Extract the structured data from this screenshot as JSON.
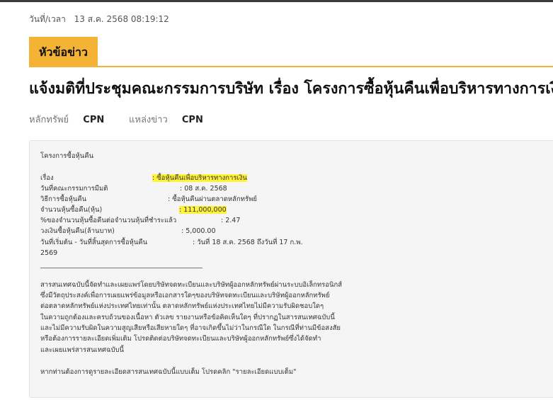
{
  "datetime": {
    "label": "วันที่/เวลา",
    "value": "13 ส.ค. 2568 08:19:12"
  },
  "section_tab": "หัวข้อข่าว",
  "headline": "แจ้งมติที่ประชุมคณะกรรมการบริษัท เรื่อง โครงการซื้อหุ้นคืนเพื่อบริหารทางการเงิน",
  "meta": {
    "security_label": "หลักทรัพย์",
    "security_value": "CPN",
    "source_label": "แหล่งข่าว",
    "source_value": "CPN"
  },
  "news": {
    "heading": "โครงการซื้อหุ้นคืน",
    "fields": [
      {
        "label": "เรื่อง",
        "value": ": ซื้อหุ้นคืนเพื่อบริหารทางการเงิน"
      },
      {
        "label": "วันที่คณะกรรมการมีมติ",
        "value": ": 08 ส.ค. 2568"
      },
      {
        "label": "วิธีการซื้อหุ้นคืน",
        "value": ": ซื้อหุ้นคืนผ่านตลาดหลักทรัพย์"
      },
      {
        "label": "จำนวนหุ้นซื้อคืน(หุ้น)",
        "value": ": 111,000,000"
      },
      {
        "label": "%ของจำนวนหุ้นซื้อคืนต่อจำนวนหุ้นที่ชำระแล้ว",
        "value": ": 2.47"
      },
      {
        "label": "วงเงินซื้อหุ้นคืน(ล้านบาท)",
        "value": ": 5,000.00"
      },
      {
        "label": "วันที่เริ่มต้น - วันที่สิ้นสุดการซื้อหุ้นคืน",
        "value": ": วันที่ 18 ส.ค. 2568 ถึงวันที่ 17 ก.พ.",
        "value_cont": "2569"
      }
    ],
    "disclaimer": [
      "สารสนเทศฉบับนี้จัดทำและเผยแพร่โดยบริษัทจดทะเบียนและบริษัทผู้ออกหลักทรัพย์ผ่านระบบอิเล็กทรอนิกส์",
      "ซึ่งมีวัตถุประสงค์เพื่อการเผยแพร่ข้อมูลหรือเอกสารใดๆของบริษัทจดทะเบียนและบริษัทผู้ออกหลักทรัพย์",
      "ต่อตลาดหลักทรัพย์แห่งประเทศไทยเท่านั้น ตลาดหลักทรัพย์แห่งประเทศไทยไม่มีความรับผิดชอบใดๆ",
      "ในความถูกต้องและครบถ้วนของเนื้อหา ตัวเลข รายงานหรือข้อคิดเห็นใดๆ ที่ปรากฏในสารสนเทศฉบับนี้",
      "และไม่มีความรับผิดในความสูญเสียหรือเสียหายใดๆ ที่อาจเกิดขึ้นไม่ว่าในกรณีใด ในกรณีที่ท่านมีข้อสงสัย",
      "หรือต้องการรายละเอียดเพิ่มเติม โปรดติดต่อบริษัทจดทะเบียนและบริษัทผู้ออกหลักทรัพย์ซึ่งได้จัดทำ",
      "และเผยแพร่สารสนเทศฉบับนี้"
    ],
    "footer": "หากท่านต้องการดูรายละเอียดสารสนเทศฉบับนี้แบบเต็ม โปรดคลิก \"รายละเอียดแบบเต็ม\""
  },
  "colors": {
    "accent": "#f5b335",
    "highlight": "#fff23a",
    "top_bar": "#3b3b3b"
  }
}
